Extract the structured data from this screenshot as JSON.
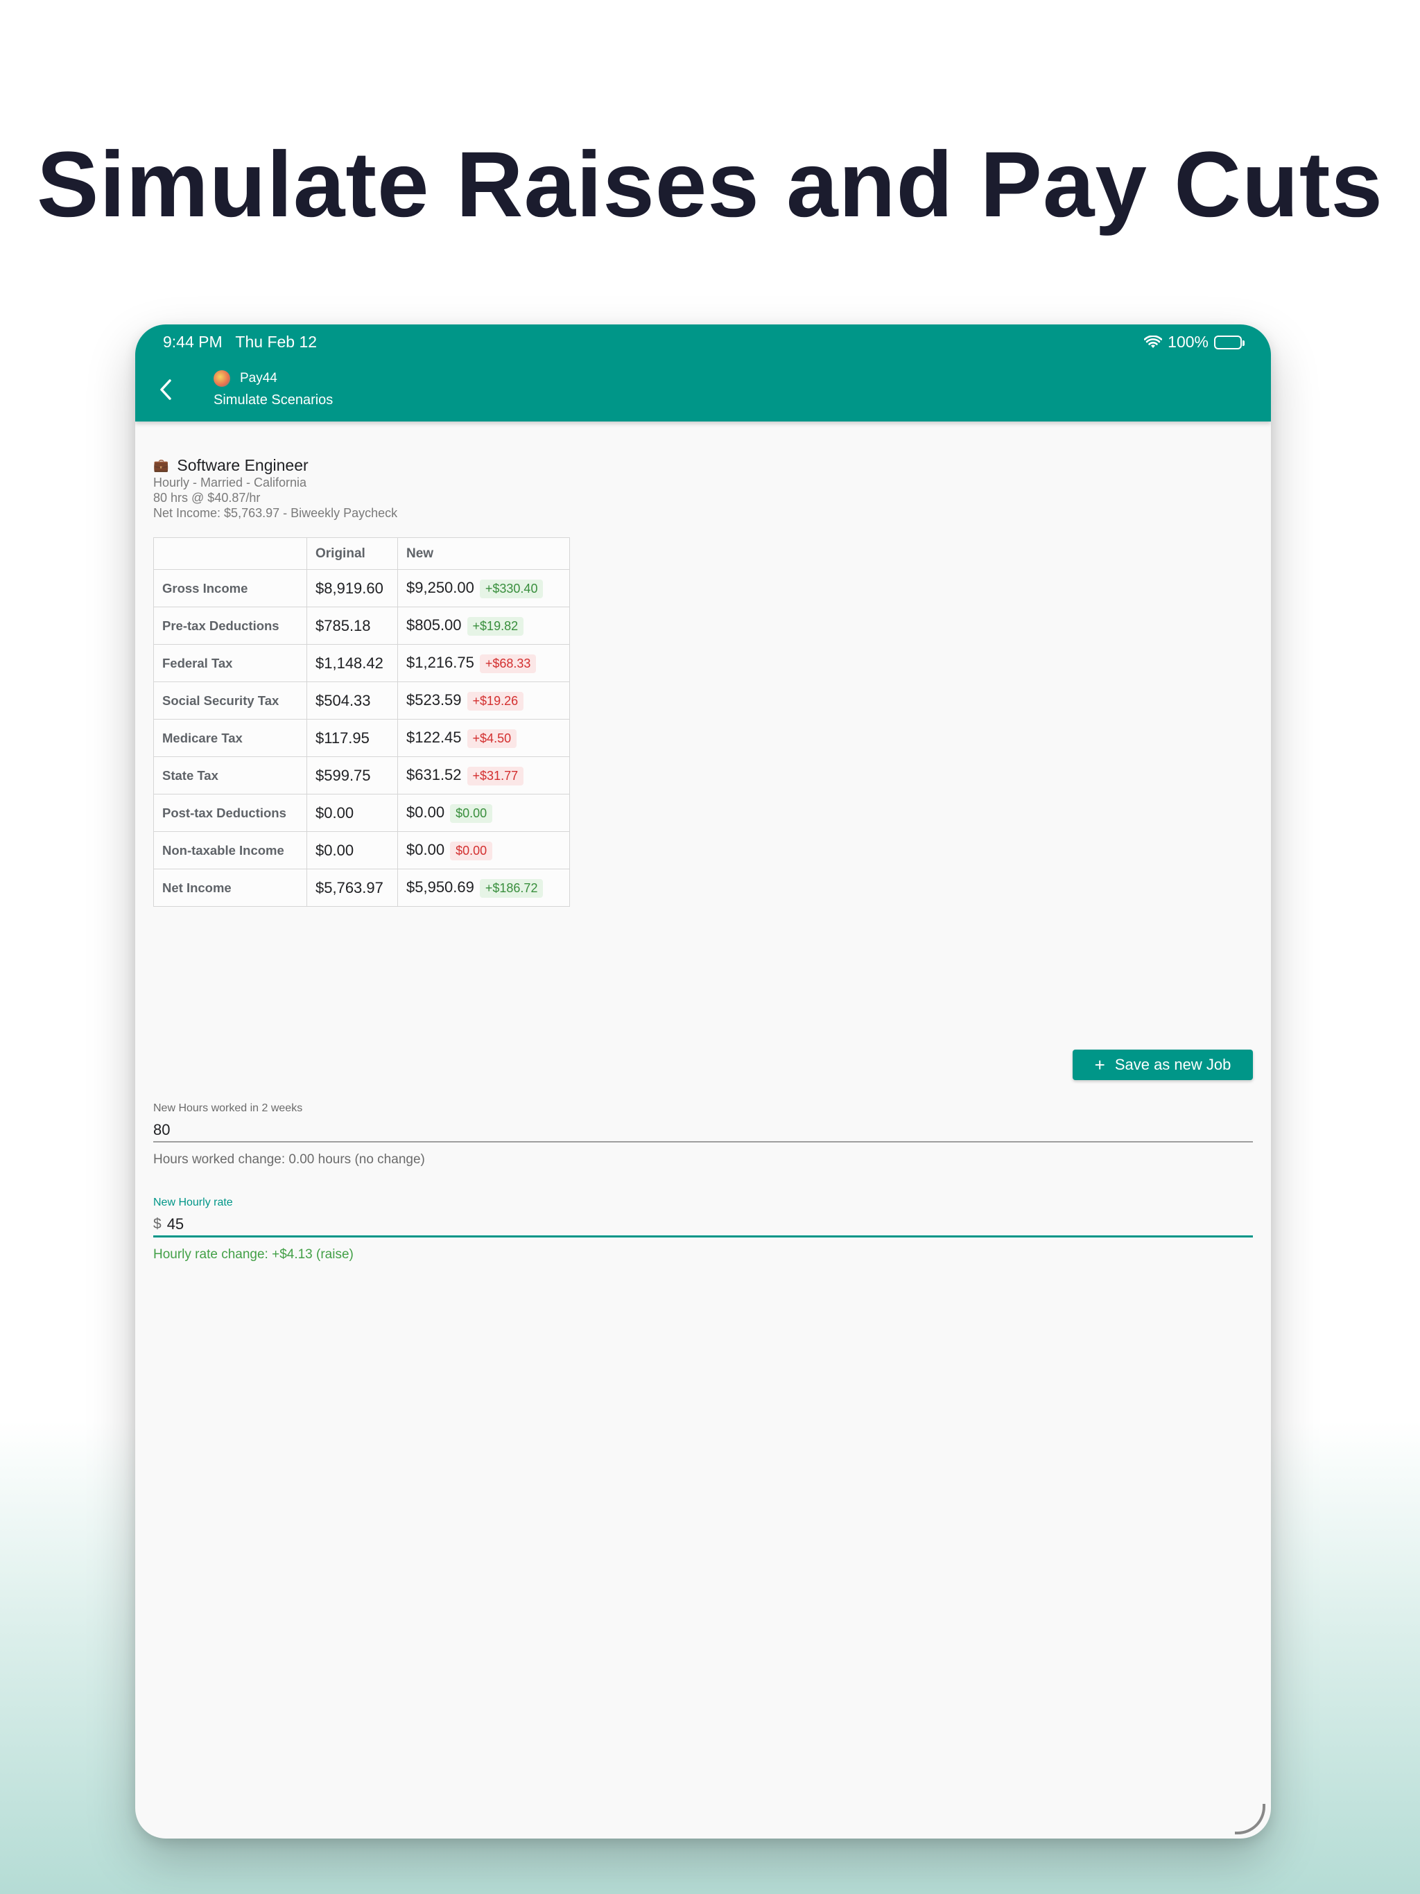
{
  "headline": "Simulate Raises and Pay Cuts",
  "status_bar": {
    "time": "9:44 PM",
    "date": "Thu Feb 12",
    "battery": "100%"
  },
  "appbar": {
    "app_name": "Pay44",
    "subtitle": "Simulate Scenarios"
  },
  "job": {
    "emoji": "💼",
    "title": "Software Engineer",
    "details": [
      "Hourly - Married - California",
      "80 hrs @ $40.87/hr",
      "Net Income: $5,763.97 - Biweekly Paycheck"
    ]
  },
  "table": {
    "headers": [
      "",
      "Original",
      "New"
    ],
    "rows": [
      {
        "label": "Gross Income",
        "original": "$8,919.60",
        "new": "$9,250.00",
        "change": "+$330.40",
        "tone": "pos"
      },
      {
        "label": "Pre-tax Deductions",
        "original": "$785.18",
        "new": "$805.00",
        "change": "+$19.82",
        "tone": "pos"
      },
      {
        "label": "Federal Tax",
        "original": "$1,148.42",
        "new": "$1,216.75",
        "change": "+$68.33",
        "tone": "neg"
      },
      {
        "label": "Social Security Tax",
        "original": "$504.33",
        "new": "$523.59",
        "change": "+$19.26",
        "tone": "neg"
      },
      {
        "label": "Medicare Tax",
        "original": "$117.95",
        "new": "$122.45",
        "change": "+$4.50",
        "tone": "neg"
      },
      {
        "label": "State Tax",
        "original": "$599.75",
        "new": "$631.52",
        "change": "+$31.77",
        "tone": "neg"
      },
      {
        "label": "Post-tax Deductions",
        "original": "$0.00",
        "new": "$0.00",
        "change": "$0.00",
        "tone": "pos"
      },
      {
        "label": "Non-taxable Income",
        "original": "$0.00",
        "new": "$0.00",
        "change": "$0.00",
        "tone": "neg"
      },
      {
        "label": "Net Income",
        "original": "$5,763.97",
        "new": "$5,950.69",
        "change": "+$186.72",
        "tone": "pos"
      }
    ]
  },
  "save_button_label": "Save as new Job",
  "hours_field": {
    "label": "New Hours worked in 2 weeks",
    "value": "80",
    "helper": "Hours worked change: 0.00 hours (no change)"
  },
  "rate_field": {
    "label": "New Hourly rate",
    "prefix": "$",
    "value": "45",
    "helper": "Hourly rate change: +$4.13 (raise)"
  },
  "colors": {
    "primary": "#009688",
    "positive": "#388e3c",
    "negative": "#d32f2f"
  },
  "icons": [
    "back-icon",
    "wifi-icon",
    "battery-icon",
    "briefcase-icon",
    "plus-icon"
  ]
}
